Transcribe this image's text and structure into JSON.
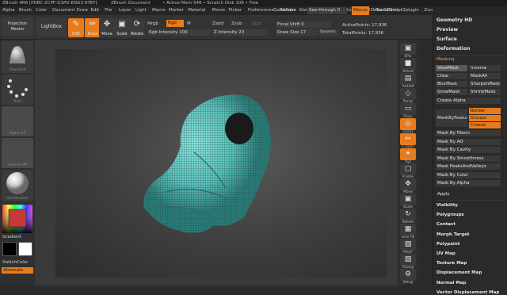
{
  "titlebar": {
    "left": "ZBrush 4R6 [PDBC-2CPF-Q1PD-ENG3-9TEF]",
    "doc": "ZBrush Document",
    "status": "• Active Mem 548 • Scratch Disk 106 • Free"
  },
  "menubar": [
    "Alpha",
    "Brush",
    "Color",
    "Document",
    "Draw",
    "Edit",
    "File",
    "Layer",
    "Light",
    "Macro",
    "Marker",
    "Material",
    "Movie",
    "Picker",
    "Preferences",
    "Render",
    "Stencil",
    "Stroke",
    "Texture",
    "Tool",
    "Transform",
    "Zplugin",
    "Zscript"
  ],
  "rightmenu": {
    "quicksave": "QuickSave",
    "seethrough": "See-through",
    "seethrough_val": "0",
    "menus": "Menus",
    "script": "DefaultZScript"
  },
  "toolbar": {
    "projection_master": "Projection Master",
    "lightbox": "LightBox",
    "edit": "Edit",
    "draw": "Draw",
    "move": "Move",
    "scale": "Scale",
    "rotate": "Rotate",
    "mrgb": "Mrgb",
    "rgb": "Rgb",
    "m": "M",
    "rgb_intensity_label": "Rgb Intensity",
    "rgb_intensity_val": "100",
    "zadd": "Zadd",
    "zsub": "Zsub",
    "zcut": "Zcut",
    "z_intensity_label": "Z Intensity",
    "z_intensity_val": "23",
    "focal_label": "Focal Shift",
    "focal_val": "0",
    "draw_size_label": "Draw Size",
    "draw_size_val": "17",
    "dynamic": "Dynamic",
    "active_points_label": "ActivePoints:",
    "active_points_val": "17,936",
    "total_points_label": "TotalPoints:",
    "total_points_val": "17,936"
  },
  "leftshelf": {
    "brush_cap": "Standard",
    "stroke_cap": "Dots",
    "alpha_cap": "Alpha Off",
    "texture_cap": "Texture Off",
    "material_cap": "SkinShade4",
    "gradient": "Gradient",
    "switchcolor": "SwitchColor",
    "alternate": "Alternate"
  },
  "rightcol": [
    "SPix",
    "Actual",
    "AAHalf",
    "Persp",
    "Floor",
    "Local",
    "L.Sym",
    "Xyz",
    "Frame",
    "Move",
    "Scale",
    "Rotate",
    "Line Fill",
    "PolyF",
    "Transp",
    "Setup"
  ],
  "panel": {
    "geometry_hd": "Geometry HD",
    "preview": "Preview",
    "surface": "Surface",
    "deformation": "Deformation",
    "masking": "Masking",
    "viewmask": "ViewMask",
    "inverse": "Inverse",
    "clear": "Clear",
    "maskall": "MaskAll",
    "blurmask": "BlurMask",
    "sharpenmask": "SharpenMask",
    "growmask": "GrowMask",
    "shrinkmask": "ShrinkMask",
    "create_alpha": "Create Alpha",
    "maskbyfeature": "MaskByFeature",
    "border": "Border",
    "groups": "Groups",
    "crease": "Crease",
    "mask_items": [
      "Mask By Fibers",
      "Mask By AO",
      "Mask By Cavity",
      "Mask By Smoothness",
      "Mask PeaksAndValleys",
      "Mask By Color",
      "Mask By Alpha"
    ],
    "apply": "Apply",
    "subs": [
      "Visibility",
      "Polygroups",
      "Contact",
      "Morph Target",
      "Polypaint",
      "UV Map",
      "Texture Map",
      "Displacement Map",
      "Normal Map",
      "Vector Displacement Map"
    ]
  }
}
